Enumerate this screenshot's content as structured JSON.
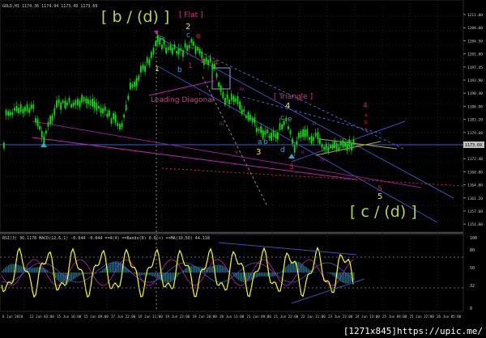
{
  "header": {
    "info_line": "GOLD,H1  1174.36 1174.94 1173.49 1173.69"
  },
  "wave_labels": {
    "b_d": "[ b / (d) ]",
    "flat": "[ Flat ]",
    "c_d": "[ c / (d) ]",
    "leading_diagonal": "Leading Diagonal",
    "triangle": "[ Triangle ]",
    "w2": "2",
    "a1": "a",
    "c1": "c",
    "e1": "e",
    "b1": "b",
    "r1": "1",
    "r1b": "1",
    "r1c": "1",
    "r2": "2",
    "r3": "3",
    "r4": "4",
    "r5": "5",
    "y3": "3",
    "y4": "4",
    "y5": "5",
    "a2": "a",
    "b2": "b",
    "c2": "c",
    "d2": "d",
    "e2": "e",
    "i1": "i",
    "ii1": "ii",
    "iii1": "iii",
    "iv1": "iv",
    "v1": "v",
    "iii2": "iii",
    "iv2": "iv",
    "iii3": "iii",
    "iv3": "iv",
    "ii2": "ii",
    "v2": "v",
    "w4_a": "a",
    "w4_b": "b",
    "w4_c": "c"
  },
  "price_axis": {
    "ticks": [
      "1211.00",
      "1208.00",
      "1204.50",
      "1201.00",
      "1197.45",
      "1193.90",
      "1190.40",
      "1186.90",
      "1183.20",
      "1179.60",
      "1175.90",
      "1172.40",
      "1168.80",
      "1164.80",
      "1161.20",
      "1157.60",
      "1154.00"
    ],
    "current_price": "1173.69"
  },
  "indicator": {
    "info_line": "RSI(3) 36.1178  MACD(12,6,1) -0.044 -0.044  ==4(4) ==Bands(0) 0.0(+)  ==MA(10,50) 44.118",
    "ticks": [
      "100",
      "80",
      "50",
      "32",
      "0"
    ]
  },
  "time_axis": {
    "ticks": [
      "8 Jun 2018",
      "12 Jun 03:00",
      "15 Jun 16:00",
      "15 Jun 09:00",
      "17 Jun 22:00",
      "19 Jun 11:00",
      "19 Jun 23:00",
      "19 Jun 20:00",
      "20 Jun 11:00",
      "21 Jun 09:00",
      "21 Jun 22:00",
      "22 Jun 11:00",
      "23 Jun 23:00",
      "24 Jun 13:00",
      "25 Jun 09:00",
      "25 Jun 22:00",
      "26 Jun 05:00"
    ]
  },
  "watermark": "[1271x845]https://upic.me/",
  "colors": {
    "candle": "#00e400",
    "bg": "#000000",
    "grid": "#1e1e1e",
    "label_green": "#b6d44a",
    "label_magenta": "#e0308f",
    "label_cyan": "#2aa8e0",
    "label_yellow": "#f5e33b",
    "label_red": "#e02020",
    "trend_blue": "#4a56c8",
    "trend_magenta": "#c020b0",
    "rsi_yellow": "#ffff00",
    "macd_cyan": "#4a8fa0"
  }
}
